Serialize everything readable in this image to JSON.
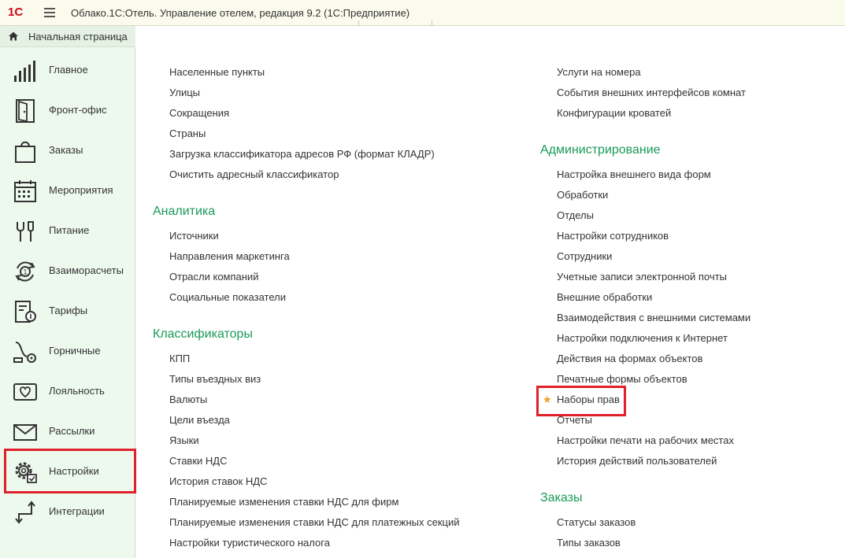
{
  "app": {
    "logo": "1С",
    "title": "Облако.1С:Отель. Управление отелем, редакция 9.2  (1С:Предприятие)"
  },
  "sidebar": {
    "home_label": "Начальная страница",
    "items": [
      {
        "label": "Главное",
        "icon": "chart-bars-icon"
      },
      {
        "label": "Фронт-офис",
        "icon": "door-icon"
      },
      {
        "label": "Заказы",
        "icon": "shopping-bag-icon"
      },
      {
        "label": "Мероприятия",
        "icon": "calendar-icon"
      },
      {
        "label": "Питание",
        "icon": "fork-glass-icon"
      },
      {
        "label": "Взаиморасчеты",
        "icon": "cycle-coin-icon"
      },
      {
        "label": "Тарифы",
        "icon": "tariff-icon"
      },
      {
        "label": "Горничные",
        "icon": "vacuum-icon"
      },
      {
        "label": "Лояльность",
        "icon": "heart-card-icon"
      },
      {
        "label": "Рассылки",
        "icon": "envelope-icon"
      },
      {
        "label": "Настройки",
        "icon": "gear-icon"
      },
      {
        "label": "Интеграции",
        "icon": "arrows-icon"
      }
    ]
  },
  "col1": {
    "top_links": [
      "Населенные пункты",
      "Улицы",
      "Сокращения",
      "Страны",
      "Загрузка классификатора адресов РФ (формат КЛАДР)",
      "Очистить адресный классификатор"
    ],
    "analytics": {
      "heading": "Аналитика",
      "links": [
        "Источники",
        "Направления маркетинга",
        "Отрасли компаний",
        "Социальные показатели"
      ]
    },
    "classifiers": {
      "heading": "Классификаторы",
      "links": [
        "КПП",
        "Типы въездных виз",
        "Валюты",
        "Цели въезда",
        "Языки",
        "Ставки НДС",
        "История ставок НДС",
        "Планируемые изменения ставки НДС для фирм",
        "Планируемые изменения ставки НДС для платежных секций",
        "Настройки туристического налога"
      ]
    }
  },
  "col2": {
    "top_links": [
      "Услуги на номера",
      "События внешних интерфейсов комнат",
      "Конфигурации кроватей"
    ],
    "admin": {
      "heading": "Администрирование",
      "links": [
        "Настройка внешнего вида форм",
        "Обработки",
        "Отделы",
        "Настройки сотрудников",
        "Сотрудники",
        "Учетные записи электронной почты",
        "Внешние обработки",
        "Взаимодействия с внешними системами",
        "Настройки подключения к Интернет",
        "Действия на формах объектов",
        "Печатные формы объектов",
        "Наборы прав",
        "Отчеты",
        "Настройки печати на рабочих местах",
        "История действий пользователей"
      ]
    },
    "orders": {
      "heading": "Заказы",
      "links": [
        "Статусы заказов",
        "Типы заказов"
      ]
    }
  },
  "colors": {
    "accent_green": "#1a9a5a",
    "highlight_red": "#e0202a",
    "star": "#f0a020",
    "sidebar_bg": "#eef9ee"
  }
}
